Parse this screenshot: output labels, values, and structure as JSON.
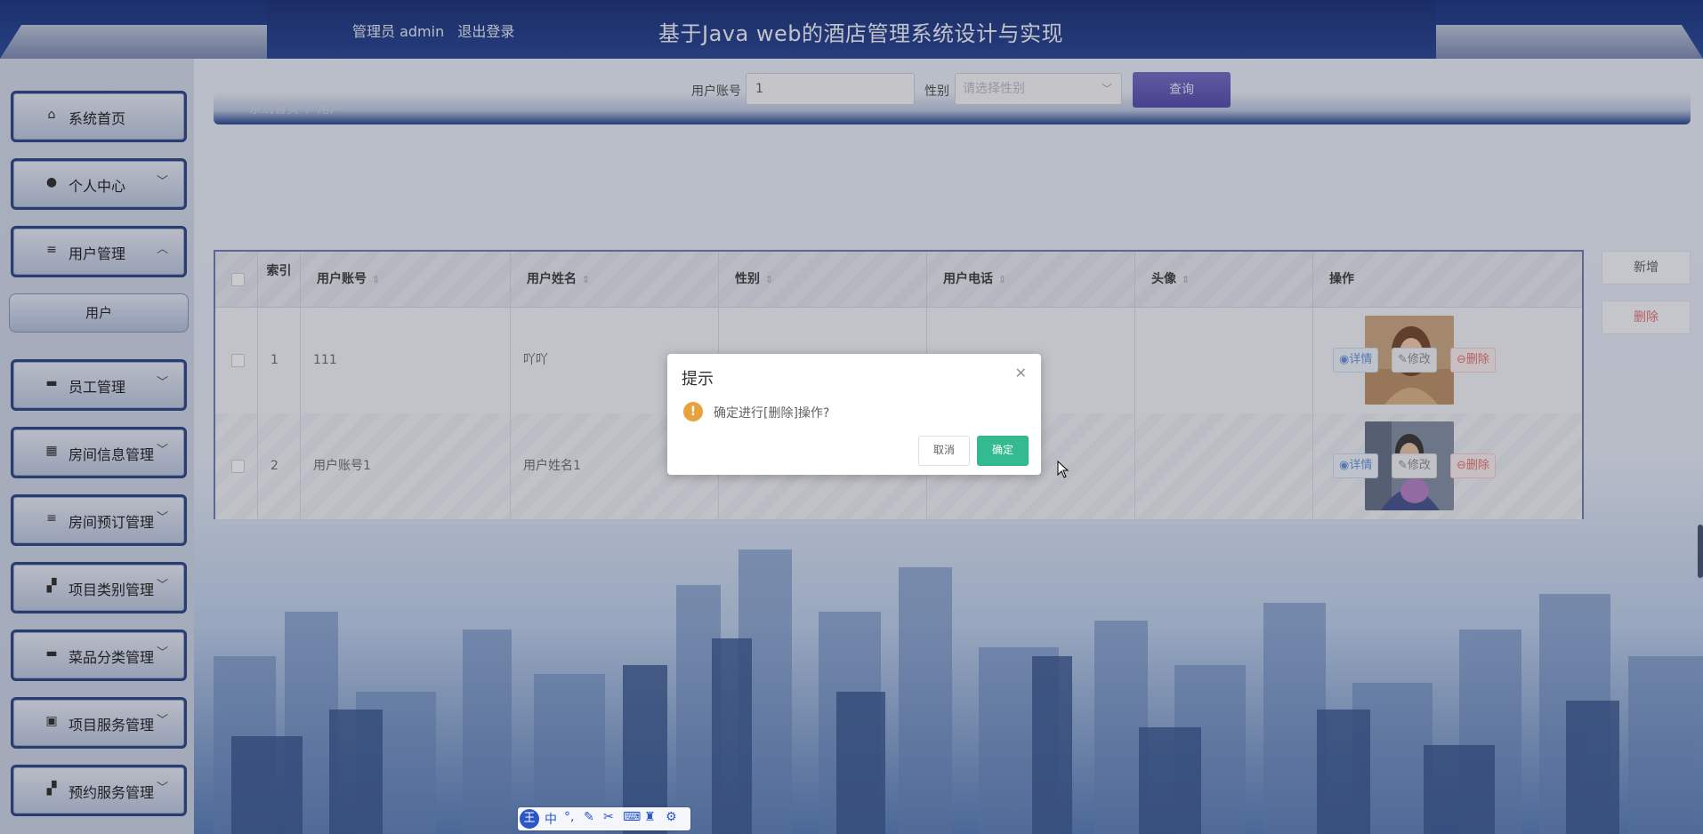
{
  "colors": {
    "header": "#0d2a78",
    "accent": "#4a41a8",
    "ok": "#33bb8f",
    "danger": "#e06b6b",
    "warning": "#e6a23c"
  },
  "header": {
    "role_text": "管理员 admin",
    "logout_label": "退出登录",
    "title": "基于Java web的酒店管理系统设计与实现"
  },
  "sidebar": {
    "items": [
      {
        "label": "系统首页",
        "icon": "home-icon"
      },
      {
        "label": "个人中心",
        "icon": "user-icon"
      },
      {
        "label": "用户管理",
        "icon": "list-icon"
      },
      {
        "label": "员工管理",
        "icon": "monitor-icon"
      },
      {
        "label": "房间信息管理",
        "icon": "grid-icon"
      },
      {
        "label": "房间预订管理",
        "icon": "list-icon"
      },
      {
        "label": "项目类别管理",
        "icon": "tiles-icon"
      },
      {
        "label": "菜品分类管理",
        "icon": "monitor-icon"
      },
      {
        "label": "项目服务管理",
        "icon": "clipboard-icon"
      },
      {
        "label": "预约服务管理",
        "icon": "tiles-icon"
      }
    ],
    "submenu_active": "用户"
  },
  "breadcrumb": {
    "home": "系统首页",
    "sep": "/",
    "current": "用户"
  },
  "search": {
    "account_label": "用户账号",
    "account_value": "1",
    "gender_label": "性别",
    "gender_placeholder": "请选择性别",
    "query_button": "查询"
  },
  "actions": {
    "add": "新增",
    "delete": "删除"
  },
  "table": {
    "headers": {
      "index": "索引",
      "account": "用户账号",
      "name": "用户姓名",
      "gender": "性别",
      "phone": "用户电话",
      "avatar": "头像",
      "ops": "操作"
    },
    "rows": [
      {
        "index": "1",
        "account": "111",
        "name": "吖吖",
        "gender": "",
        "phone": ""
      },
      {
        "index": "2",
        "account": "用户账号1",
        "name": "用户姓名1",
        "gender": "",
        "phone": ""
      }
    ],
    "op_detail": "详情",
    "op_edit": "修改",
    "op_delete": "删除"
  },
  "dialog": {
    "title": "提示",
    "message": "确定进行[删除]操作?",
    "cancel": "取消",
    "confirm": "确定"
  },
  "ime": {
    "logo": "王",
    "lang": "中"
  }
}
